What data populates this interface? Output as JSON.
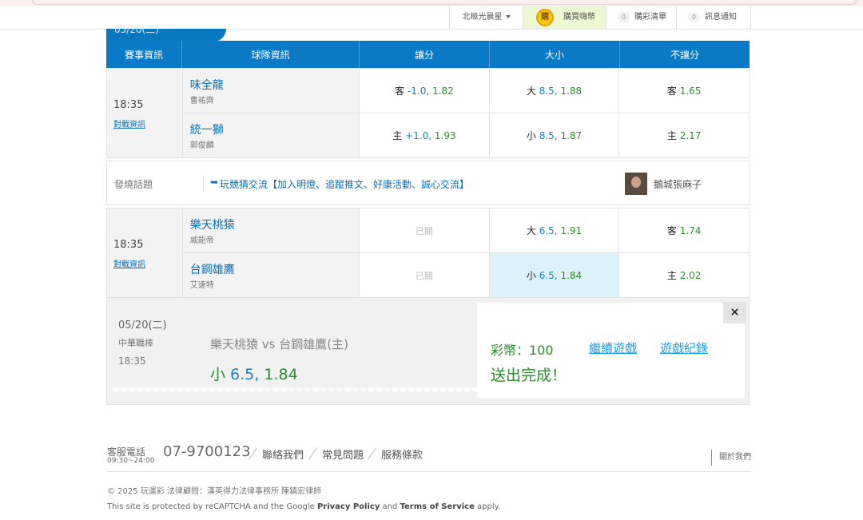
{
  "topbar": {
    "user": "北極光晨星",
    "coin_icon_text": "購",
    "coin_label": "購買嗨幣",
    "cart_count": "0",
    "cart_label": "購彩清單",
    "notice_count": "0",
    "notice_label": "訊息通知"
  },
  "date_tab": "05/20(二)",
  "headers": [
    "賽事資訊",
    "球隊資訊",
    "讓分",
    "大小",
    "不讓分"
  ],
  "games": [
    {
      "time": "18:35",
      "vs_link": "對戰資訊",
      "away": {
        "team": "味全龍",
        "pitcher": "曹祐齊",
        "spread_side": "客",
        "spread_hcp": "-1.0",
        "spread_odds": "1.82",
        "ou_side": "大",
        "ou_line": "8.5",
        "ou_odds": "1.88",
        "ml_side": "客",
        "ml_odds": "1.65"
      },
      "home": {
        "team": "統一獅",
        "pitcher": "郭俊麟",
        "spread_side": "主",
        "spread_hcp": "+1.0",
        "spread_odds": "1.93",
        "ou_side": "小",
        "ou_line": "8.5",
        "ou_odds": "1.87",
        "ml_side": "主",
        "ml_odds": "2.17"
      }
    },
    {
      "time": "18:35",
      "vs_link": "對戰資訊",
      "away": {
        "team": "樂天桃猿",
        "pitcher": "威能帝",
        "spread_closed": "已關",
        "ou_side": "大",
        "ou_line": "6.5",
        "ou_odds": "1.91",
        "ml_side": "客",
        "ml_odds": "1.74"
      },
      "home": {
        "team": "台鋼雄鷹",
        "pitcher": "艾速特",
        "spread_closed": "已關",
        "ou_side": "小",
        "ou_line": "6.5",
        "ou_odds": "1.84",
        "ml_side": "主",
        "ml_odds": "2.02"
      }
    }
  ],
  "topic": {
    "label": "發燒話題",
    "arrow": "➥",
    "text": "玩競猜交流【加入明燈、追蹤推文、好康活動、誠心交流】",
    "user": "鵝城張麻子"
  },
  "confirm": {
    "date": "05/20(二)",
    "league": "中華職棒",
    "time": "18:35",
    "match": "樂天桃猿 vs 台鋼雄鷹(主)",
    "bet_side": "小 ",
    "bet_line": "6.5,",
    "bet_odds": " 1.84",
    "coins": "彩幣：100",
    "continue_label": "繼續遊戲",
    "history_label": "遊戲紀錄",
    "status": "送出完成！",
    "close": "×"
  },
  "footer": {
    "service_label": "客服電話",
    "hours": "09:30~24:00",
    "phone": "07-9700123",
    "links": [
      "聯絡我們",
      "常見問題",
      "服務條款"
    ],
    "about": "關於我們",
    "copyright": "© 2025 玩運彩 法律顧問：漢英得力法律事務所 陳鎮宏律師",
    "recaptcha_pre": "This site is protected by reCAPTCHA and the Google ",
    "privacy": "Privacy Policy",
    "and": " and ",
    "terms": "Terms of Service",
    "apply": " apply."
  },
  "colors": {
    "header_blue": "#0a7ac6",
    "odds_green": "#2e8b2e",
    "link_blue": "#0a6fb5",
    "selected_bg": "#ddf1fb"
  }
}
